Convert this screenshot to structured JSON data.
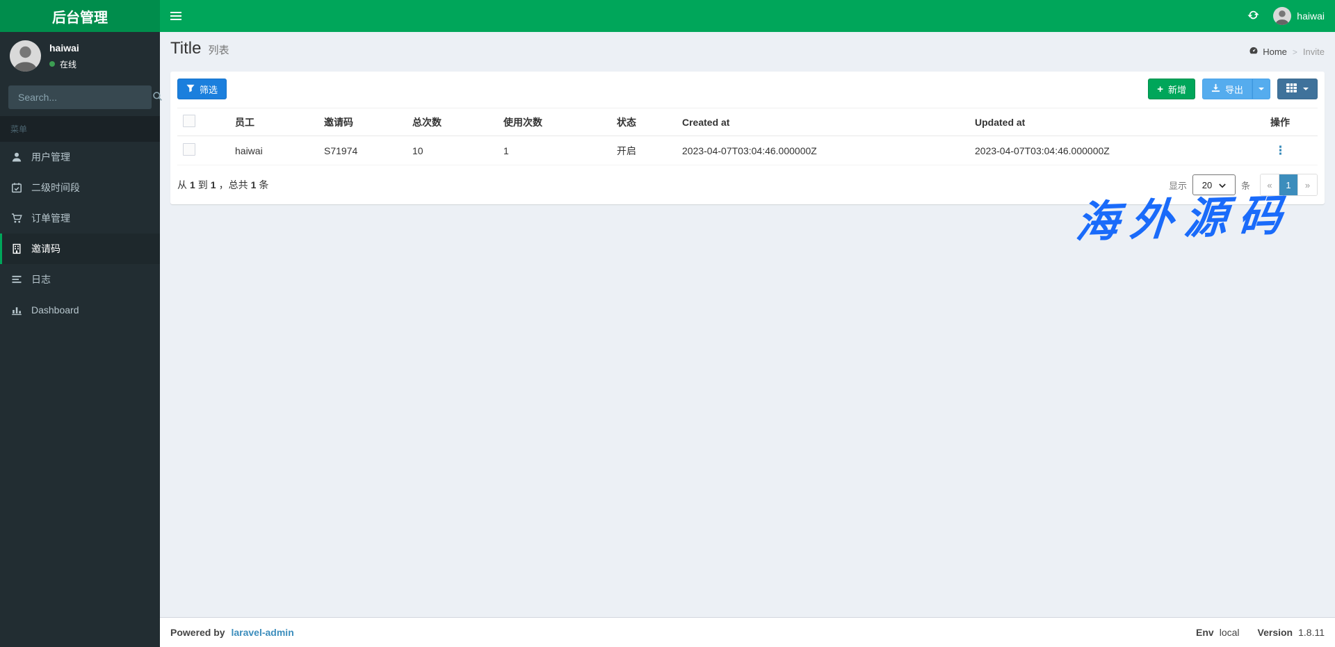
{
  "navbar": {
    "logo": "后台管理",
    "user_name": "haiwai"
  },
  "sidebar": {
    "user_name": "haiwai",
    "user_status": "在线",
    "search_placeholder": "Search...",
    "menu_header": "菜单",
    "items": [
      {
        "label": "用户管理",
        "icon": "user-icon",
        "active": false
      },
      {
        "label": "二级时间段",
        "icon": "calendar-icon",
        "active": false
      },
      {
        "label": "订单管理",
        "icon": "cart-icon",
        "active": false
      },
      {
        "label": "邀请码",
        "icon": "invite-code-icon",
        "active": true
      },
      {
        "label": "日志",
        "icon": "log-icon",
        "active": false
      },
      {
        "label": "Dashboard",
        "icon": "bar-chart-icon",
        "active": false
      }
    ]
  },
  "page": {
    "title": "Title",
    "subtitle": "列表"
  },
  "breadcrumb": {
    "home": "Home",
    "current": "Invite"
  },
  "toolbar": {
    "filter_label": "筛选",
    "new_label": "新增",
    "export_label": "导出"
  },
  "table": {
    "columns": [
      "员工",
      "邀请码",
      "总次数",
      "使用次数",
      "状态",
      "Created at",
      "Updated at",
      "操作"
    ],
    "rows": [
      {
        "employee": "haiwai",
        "code": "S71974",
        "total": "10",
        "used": "1",
        "status": "开启",
        "created_at": "2023-04-07T03:04:46.000000Z",
        "updated_at": "2023-04-07T03:04:46.000000Z"
      }
    ]
  },
  "grid_footer": {
    "summary": {
      "from_label": "从",
      "from": "1",
      "to_label": "到",
      "to": "1",
      "total_label": "，总共",
      "total": "1",
      "unit": "条"
    },
    "show_label": "显示",
    "page_size": "20",
    "per_label": "条",
    "prev": "«",
    "page": "1",
    "next": "»"
  },
  "watermark": {
    "text": "海外源码",
    "color": "#1a6bfa"
  },
  "footer": {
    "powered_label": "Powered by",
    "powered_link": "laravel-admin",
    "env_label": "Env",
    "env_value": "local",
    "version_label": "Version",
    "version_value": "1.8.11"
  },
  "icons": {
    "more_vertical": "⋮",
    "plus": "+"
  },
  "colors": {
    "navbar_green": "#00a65a",
    "logo_green": "#008d4c",
    "sidebar_dark": "#222d32",
    "filter_blue": "#1b7fdd",
    "export_blue": "#55acee",
    "grid_blue": "#3f729b",
    "pagination_active": "#3c8dbc",
    "watermark_blue": "#1a6bfa"
  }
}
